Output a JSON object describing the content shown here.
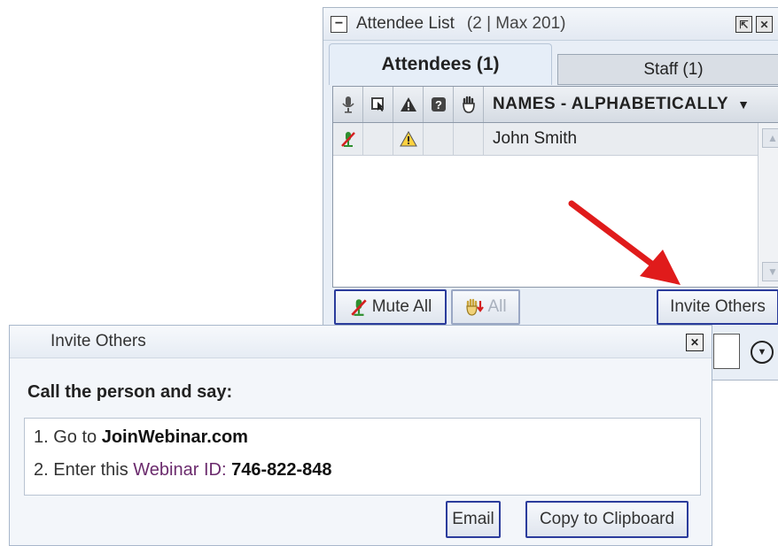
{
  "attendee_panel": {
    "title": "Attendee List",
    "count": "(2 | Max 201)",
    "tabs": [
      {
        "label": "Attendees (1)",
        "active": true
      },
      {
        "label": "Staff (1)",
        "active": false
      }
    ],
    "columns": {
      "icons": [
        "microphone-icon",
        "screen-icon",
        "warning-icon",
        "question-icon",
        "hand-icon"
      ],
      "names_header": "NAMES - ALPHABETICALLY"
    },
    "rows": [
      {
        "name": "John Smith",
        "muted": true,
        "warning": true
      }
    ],
    "buttons": {
      "mute_all": "Mute All",
      "all": "All",
      "invite_others": "Invite Others"
    }
  },
  "invite_dialog": {
    "title": "Invite Others",
    "heading": "Call the person and say:",
    "step1_prefix": "1. Go to ",
    "step1_site": "JoinWebinar.com",
    "step2_prefix": "2. Enter this ",
    "step2_accent": "Webinar ID:",
    "step2_id": "746-822-848",
    "buttons": {
      "email": "Email",
      "copy": "Copy to Clipboard"
    }
  },
  "colors": {
    "button_border": "#2b3c9c",
    "annotation_arrow": "#e01b1b",
    "accent_text": "#6b2b6d"
  }
}
